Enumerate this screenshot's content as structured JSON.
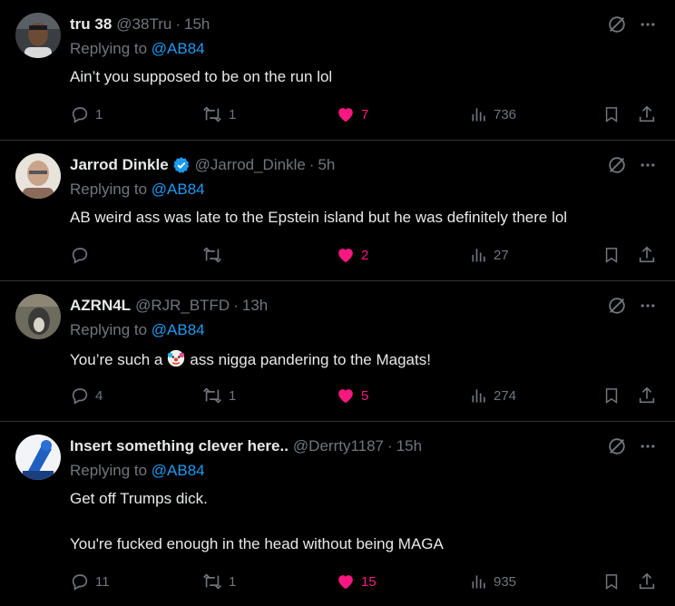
{
  "posts": [
    {
      "display_name": "tru 38",
      "handle": "@38Tru",
      "time": "15h",
      "replying_prefix": "Replying to",
      "replying_to": "@AB84",
      "text": [
        "Ain’t you supposed to be on the run lol"
      ],
      "replies": "1",
      "reposts": "1",
      "likes": "7",
      "views": "736",
      "verified": false
    },
    {
      "display_name": "Jarrod Dinkle",
      "handle": "@Jarrod_Dinkle",
      "time": "5h",
      "replying_prefix": "Replying to",
      "replying_to": "@AB84",
      "text": [
        "AB weird ass was late to the Epstein island but he was definitely there lol"
      ],
      "replies": "",
      "reposts": "",
      "likes": "2",
      "views": "27",
      "verified": true
    },
    {
      "display_name": "AZRN4L",
      "handle": "@RJR_BTFD",
      "time": "13h",
      "replying_prefix": "Replying to",
      "replying_to": "@AB84",
      "text_before_emoji": "You’re such a",
      "text_after_emoji": "ass nigga pandering to the Magats!",
      "replies": "4",
      "reposts": "1",
      "likes": "5",
      "views": "274",
      "verified": false
    },
    {
      "display_name": "Insert something clever here..",
      "handle": "@Derrty1187",
      "time": "15h",
      "replying_prefix": "Replying to",
      "replying_to": "@AB84",
      "text": [
        "Get off Trumps dick.",
        "You're fucked enough in the head without being MAGA"
      ],
      "replies": "11",
      "reposts": "1",
      "likes": "15",
      "views": "935",
      "verified": false
    }
  ],
  "separator_dot": "·",
  "colors": {
    "background": "#000000",
    "text": "#e7e9ea",
    "muted": "#71767b",
    "mention": "#1d9bf0",
    "like": "#f91880",
    "divider": "#2f3336"
  },
  "icons": [
    "reply-icon",
    "repost-icon",
    "heart-icon",
    "views-icon",
    "bookmark-icon",
    "share-icon",
    "grok-icon",
    "more-icon",
    "verified-badge-icon",
    "clown-emoji"
  ]
}
